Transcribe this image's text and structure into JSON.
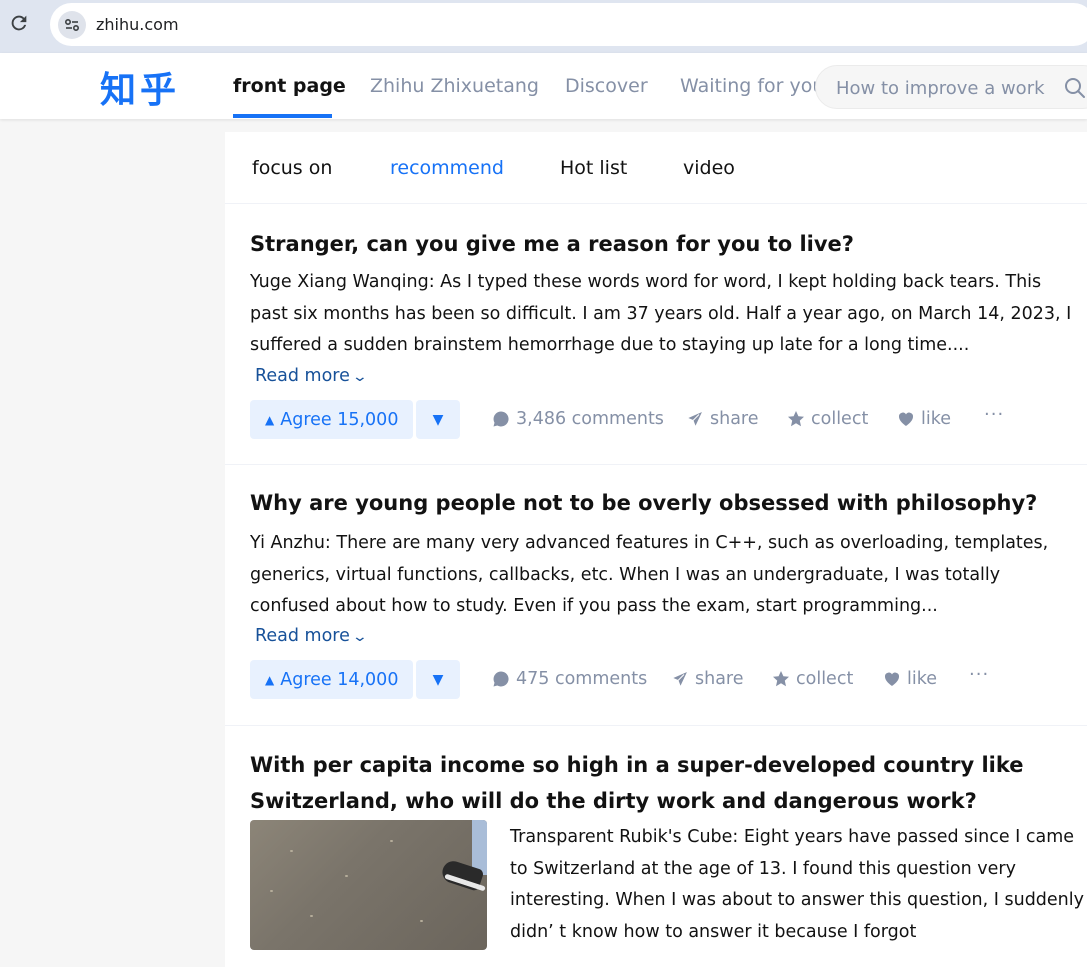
{
  "browser": {
    "url": "zhihu.com"
  },
  "header": {
    "logo": "知乎",
    "nav": [
      {
        "label": "front page",
        "active": true
      },
      {
        "label": "Zhihu Zhixuetang",
        "active": false
      },
      {
        "label": "Discover",
        "active": false
      },
      {
        "label": "Waiting for you",
        "active": false
      }
    ],
    "search_placeholder": "How to improve a work"
  },
  "tabs": [
    {
      "label": "focus on",
      "active": false
    },
    {
      "label": "recommend",
      "active": true
    },
    {
      "label": "Hot list",
      "active": false
    },
    {
      "label": "video",
      "active": false
    }
  ],
  "items": [
    {
      "title": "Stranger, can you give me a reason for you to live?",
      "excerpt": "Yuge Xiang Wanqing: As I typed these words word for word, I kept holding back tears. This past six months has been so difficult. I am 37 years old. Half a year ago, on March 14, 2023, I suffered a sudden brainstem hemorrhage due to staying up late for a long time....",
      "read_more": "Read more",
      "agree": "Agree 15,000",
      "comments": "3,486 comments",
      "share": "share",
      "collect": "collect",
      "like": "like"
    },
    {
      "title": "Why are young people not to be overly obsessed with philosophy?",
      "excerpt": "Yi Anzhu: There are many very advanced features in C++, such as overloading, templates, generics, virtual functions, callbacks, etc. When I was an undergraduate, I was totally confused about how to study. Even if you pass the exam, start programming...",
      "read_more": "Read more",
      "agree": "Agree 14,000",
      "comments": "475 comments",
      "share": "share",
      "collect": "collect",
      "like": "like"
    },
    {
      "title": "With per capita income so high in a super-developed country like Switzerland, who will do the dirty work and dangerous work?",
      "excerpt": "Transparent Rubik's Cube: Eight years have passed since I came to Switzerland at the age of 13. I found this question very interesting. When I was about to answer this question, I suddenly didn’ t know how to answer it because I forgot"
    }
  ],
  "colors": {
    "brand": "#1772f6",
    "read_more": "#175199",
    "muted": "#8590a6"
  }
}
